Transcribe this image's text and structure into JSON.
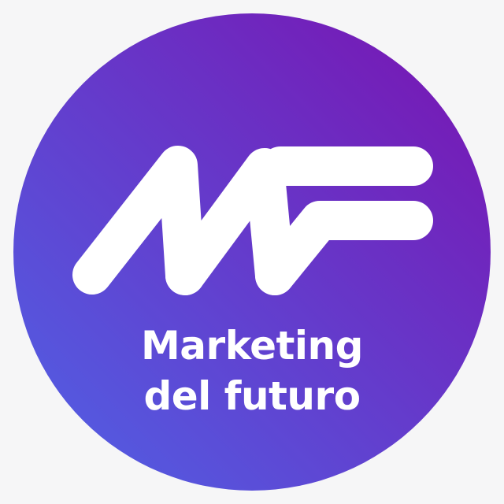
{
  "brand": {
    "monogram": "MF",
    "tagline_line_1": "Marketing",
    "tagline_line_2": "del futuro"
  },
  "colors": {
    "background": "#f6f6f7",
    "gradient_start": "#4f63e6",
    "gradient_end": "#7a12b0",
    "foreground": "#ffffff"
  }
}
